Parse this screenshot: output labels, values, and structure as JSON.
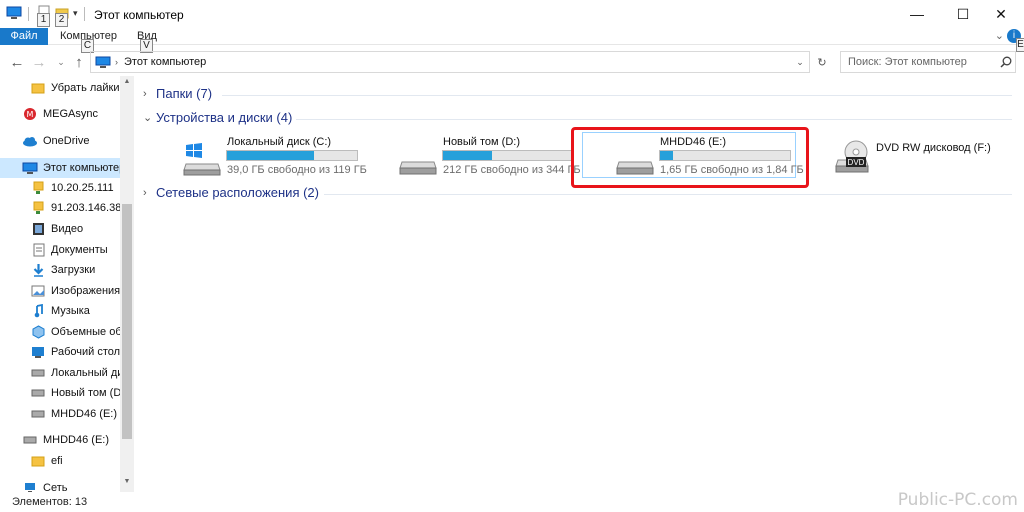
{
  "window": {
    "title": "Этот компьютер",
    "keytips": {
      "qa1": "1",
      "qa2": "2",
      "computer": "C",
      "view": "V",
      "help": "E"
    },
    "controls": {
      "minimize": "—",
      "maximize": "☐",
      "close": "✕"
    }
  },
  "ribbon": {
    "file_tab": "Файл",
    "tabs": [
      "Компьютер",
      "Вид"
    ],
    "help": "i"
  },
  "address": {
    "path": "Этот компьютер",
    "search_placeholder": "Поиск: Этот компьютер"
  },
  "sidebar": {
    "items": [
      {
        "label": "Убрать лайки Вк",
        "icon": "folder-icon"
      },
      {
        "label": "MEGAsync",
        "icon": "mega-icon"
      },
      {
        "label": "OneDrive",
        "icon": "cloud-icon"
      },
      {
        "label": "Этот компьютер",
        "icon": "computer-icon"
      },
      {
        "label": "10.20.25.111",
        "icon": "network-drive-icon"
      },
      {
        "label": "91.203.146.38",
        "icon": "network-drive-icon"
      },
      {
        "label": "Видео",
        "icon": "video-icon"
      },
      {
        "label": "Документы",
        "icon": "documents-icon"
      },
      {
        "label": "Загрузки",
        "icon": "download-icon"
      },
      {
        "label": "Изображения",
        "icon": "images-icon"
      },
      {
        "label": "Музыка",
        "icon": "music-icon"
      },
      {
        "label": "Объемные объ",
        "icon": "3d-objects-icon"
      },
      {
        "label": "Рабочий стол",
        "icon": "desktop-icon"
      },
      {
        "label": "Локальный дис",
        "icon": "drive-icon"
      },
      {
        "label": "Новый том (D:)",
        "icon": "drive-icon"
      },
      {
        "label": "MHDD46 (E:)",
        "icon": "drive-icon"
      },
      {
        "label": "MHDD46 (E:)",
        "icon": "drive-icon"
      },
      {
        "label": "efi",
        "icon": "folder-icon"
      },
      {
        "label": "Сеть",
        "icon": "network-icon"
      }
    ]
  },
  "groups": {
    "folders": "Папки (7)",
    "devices": "Устройства и диски (4)",
    "network": "Сетевые расположения (2)"
  },
  "drives": [
    {
      "name": "Локальный диск (C:)",
      "free_text": "39,0 ГБ свободно из 119 ГБ",
      "used_fraction": 0.67,
      "icon": "windows-drive-icon"
    },
    {
      "name": "Новый том (D:)",
      "free_text": "212 ГБ свободно из 344 ГБ",
      "used_fraction": 0.38,
      "icon": "hard-drive-icon"
    },
    {
      "name": "MHDD46 (E:)",
      "free_text": "1,65 ГБ свободно из 1,84 ГБ",
      "used_fraction": 0.1,
      "icon": "hard-drive-icon"
    },
    {
      "name": "DVD RW дисковод (F:)",
      "icon": "dvd-drive-icon",
      "icon_label": "DVD"
    }
  ],
  "status": {
    "items_count": "Элементов: 13"
  },
  "watermark": "Public-PC.com",
  "colors": {
    "accent": "#1979ca",
    "progress": "#26a0da",
    "highlight": "#e8141a",
    "group_header": "#1e3287",
    "selection": "#cce8ff"
  }
}
